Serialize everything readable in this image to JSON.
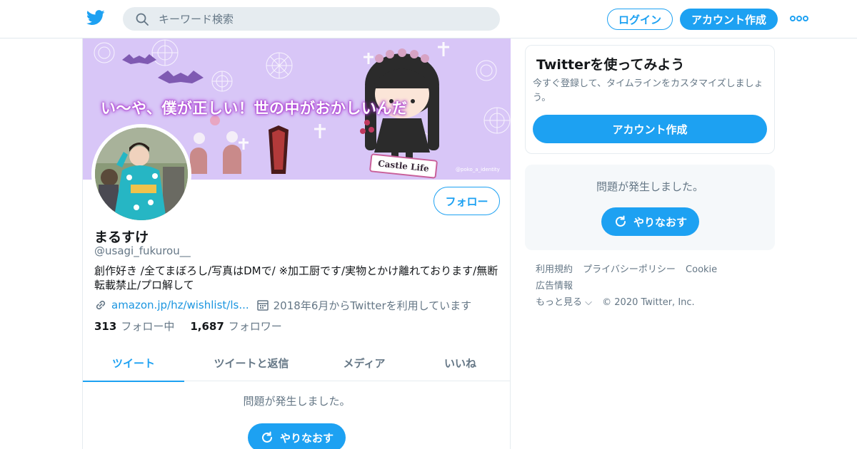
{
  "header": {
    "logo_icon": "twitter-bird-icon",
    "search_placeholder": "キーワード検索",
    "login_label": "ログイン",
    "signup_label": "アカウント作成",
    "more_icon": "more-dots-icon",
    "accent_color": "#1da1f2"
  },
  "profile": {
    "banner_text": "い〜や、僕が正しい！世の中がおかしいんだ",
    "banner_sign": "Castle Life",
    "banner_credit": "@poko_a_identity",
    "follow_label": "フォロー",
    "name": "まるすけ",
    "handle": "@usagi_fukurou__",
    "bio": "創作好き /全てまぼろし/写真はDMで/ ※加工厨です/実物とかけ離れております/無断転載禁止/プロ解して",
    "link": "amazon.jp/hz/wishlist/ls...",
    "joined": "2018年6月からTwitterを利用しています",
    "following_count": "313",
    "following_label": "フォロー中",
    "followers_count": "1,687",
    "followers_label": "フォロワー"
  },
  "tabs": [
    {
      "label": "ツイート",
      "active": true
    },
    {
      "label": "ツイートと返信",
      "active": false
    },
    {
      "label": "メディア",
      "active": false
    },
    {
      "label": "いいね",
      "active": false
    }
  ],
  "timeline": {
    "error_message": "問題が発生しました。",
    "retry_label": "やりなおす"
  },
  "sidebar": {
    "signup_title": "Twitterを使ってみよう",
    "signup_desc": "今すぐ登録して、タイムラインをカスタマイズしましょう。",
    "signup_cta": "アカウント作成",
    "error_message": "問題が発生しました。",
    "retry_label": "やりなおす"
  },
  "footer": {
    "links": [
      "利用規約",
      "プライバシーポリシー",
      "Cookie",
      "広告情報",
      "もっと見る ⌵"
    ],
    "copyright": "© 2020 Twitter, Inc."
  }
}
